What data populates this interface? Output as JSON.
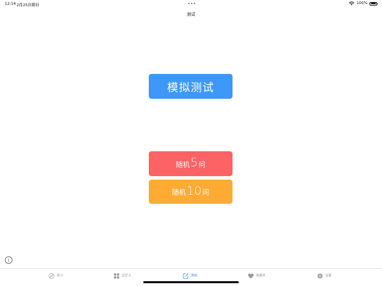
{
  "status_bar": {
    "time": "12:14",
    "date": "2月25日周日",
    "battery_pct": "100%"
  },
  "nav": {
    "title": "测试"
  },
  "buttons": {
    "mock_test": {
      "label": "模拟测试",
      "color": "#3d98f8"
    },
    "random5": {
      "prefix": "随机",
      "count": "5",
      "suffix": "问",
      "color": "#fd6264"
    },
    "random10": {
      "prefix": "随机",
      "count": "10",
      "suffix": "问",
      "color": "#fdab32"
    }
  },
  "tabs": [
    {
      "label": "练习",
      "icon": "compass-icon",
      "active": false
    },
    {
      "label": "自定义",
      "icon": "grid-icon",
      "active": false
    },
    {
      "label": "测试",
      "icon": "edit-icon",
      "active": true
    },
    {
      "label": "收藏夹",
      "icon": "heart-icon",
      "active": false
    },
    {
      "label": "设置",
      "icon": "gear-icon",
      "active": false
    }
  ],
  "colors": {
    "active_tab": "#2f86f6",
    "inactive_tab": "#999999"
  }
}
